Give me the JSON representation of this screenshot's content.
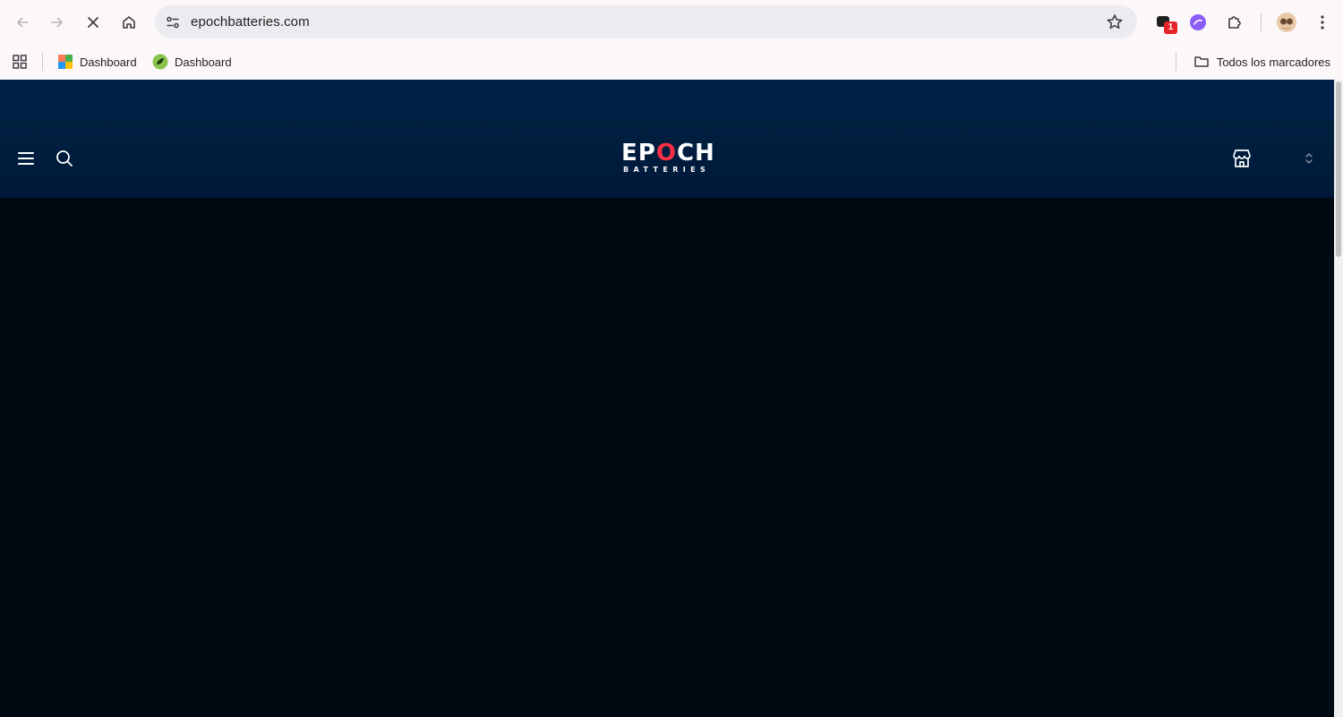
{
  "browser": {
    "url": "epochbatteries.com",
    "extension_badge": "1",
    "bookmarks": [
      {
        "label": "Dashboard",
        "icon": "puzzle-favicon"
      },
      {
        "label": "Dashboard",
        "icon": "green-leaf-favicon"
      }
    ],
    "all_bookmarks_label": "Todos los marcadores"
  },
  "site": {
    "logo_main": "EPOCH",
    "logo_sub": "BATTERIES",
    "colors": {
      "announcement_bar": "#00204a",
      "header": "#002040",
      "body": "#000812",
      "logo_accent": "#ff3044"
    }
  }
}
